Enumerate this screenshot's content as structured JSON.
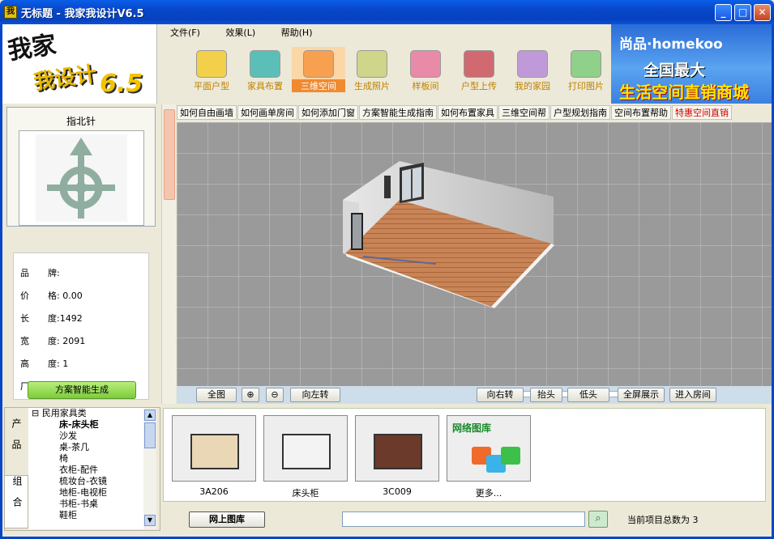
{
  "window": {
    "title": "无标题 - 我家我设计V6.5",
    "controls": {
      "minimize": "_",
      "maximize": "□",
      "close": "✕"
    }
  },
  "logo": {
    "line1": "我家",
    "line2": "我设计",
    "version": "6.5"
  },
  "menu": [
    {
      "label": "文件(F)"
    },
    {
      "label": "效果(L)"
    },
    {
      "label": "帮助(H)"
    }
  ],
  "toolbar": [
    {
      "label": "平面户型",
      "icon": "pencil-icon",
      "color": "#f3d04a"
    },
    {
      "label": "家具布置",
      "icon": "chair-icon",
      "color": "#5bbfb8"
    },
    {
      "label": "三维空间",
      "icon": "cube-icon",
      "color": "#f7a050",
      "active": true
    },
    {
      "label": "生成照片",
      "icon": "camera-icon",
      "color": "#cfd58a"
    },
    {
      "label": "样板间",
      "icon": "sample-room-icon",
      "color": "#e88aa8"
    },
    {
      "label": "户型上传",
      "icon": "floppy-disk-icon",
      "color": "#d06a70"
    },
    {
      "label": "我的家园",
      "icon": "house-icon",
      "color": "#c09ad8"
    },
    {
      "label": "打印图片",
      "icon": "printer-icon",
      "color": "#8fd08a"
    }
  ],
  "ad": {
    "line1": "尚品·homekoo",
    "line2": "全国最大",
    "line3": "生活空间直销商城"
  },
  "compass": {
    "title": "指北针",
    "icon": "compass-arrow-icon"
  },
  "properties": [
    {
      "label": "品",
      "value": "牌:"
    },
    {
      "label": "价",
      "value": "格: 0.00"
    },
    {
      "label": "长",
      "value": "度:1492"
    },
    {
      "label": "宽",
      "value": "度: 2091"
    },
    {
      "label": "高",
      "value": "度: 1"
    },
    {
      "label": "厂",
      "value": ""
    }
  ],
  "smart_generate_label": "方案智能生成",
  "help_tabs": [
    {
      "label": "如何自由画墙"
    },
    {
      "label": "如何画单房间"
    },
    {
      "label": "如何添加门窗"
    },
    {
      "label": "方案智能生成指南"
    },
    {
      "label": "如何布置家具"
    },
    {
      "label": "三维空间帮"
    },
    {
      "label": "户型规划指南"
    },
    {
      "label": "空间布置帮助"
    },
    {
      "label": "特惠空间直销",
      "red": true
    }
  ],
  "view_controls": [
    {
      "label": "全图"
    },
    {
      "label": "⊕"
    },
    {
      "label": "⊖"
    },
    {
      "label": "向左转"
    },
    {
      "label": "向右转"
    },
    {
      "label": "抬头"
    },
    {
      "label": "低头"
    },
    {
      "label": "全屏展示"
    },
    {
      "label": "进入房间"
    }
  ],
  "slider": {
    "value": 0.5
  },
  "category_tabs": {
    "products": "产品",
    "groups": "组合"
  },
  "category_tree": {
    "root": "民用家具类",
    "items": [
      {
        "label": "床-床头柜",
        "selected": true
      },
      {
        "label": "沙发"
      },
      {
        "label": "桌-茶几"
      },
      {
        "label": "椅"
      },
      {
        "label": "衣柜-配件"
      },
      {
        "label": "梳妆台-衣镜"
      },
      {
        "label": "地柜-电视柜"
      },
      {
        "label": "书柜-书桌"
      },
      {
        "label": "鞋柜"
      }
    ]
  },
  "products": [
    {
      "label": "3A206",
      "icon": "bed-thumbnail"
    },
    {
      "label": "床头柜",
      "icon": "nightstand-thumbnail"
    },
    {
      "label": "3C009",
      "icon": "nightstand-dark-thumbnail"
    },
    {
      "label": "更多...",
      "icon": "network-library-icon",
      "badge": "网络图库"
    }
  ],
  "bottom": {
    "net_library_label": "网上图库",
    "search_value": "",
    "search_icon": "search-icon",
    "count_text": "当前项目总数为 3"
  }
}
